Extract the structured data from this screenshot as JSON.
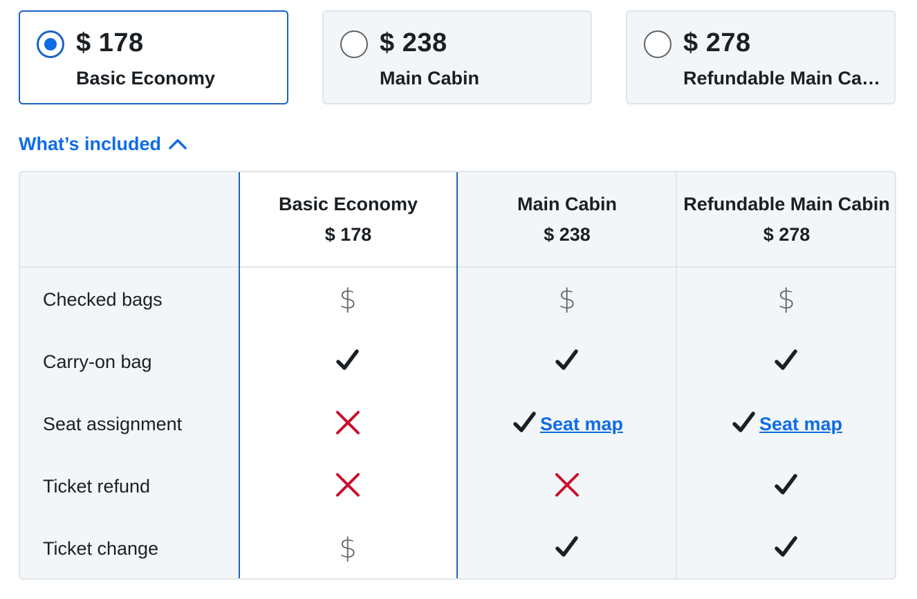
{
  "fare_options": [
    {
      "price": "$ 178",
      "name": "Basic Economy",
      "selected": true
    },
    {
      "price": "$ 238",
      "name": "Main Cabin",
      "selected": false
    },
    {
      "price": "$ 278",
      "name": "Refundable Main Cabin",
      "selected": false
    }
  ],
  "whats_included": {
    "label": "What’s included",
    "icon": "chevron-up-icon",
    "expanded": true
  },
  "comparison_table": {
    "columns": [
      {
        "name": "Basic Economy",
        "price": "$ 178"
      },
      {
        "name": "Main Cabin",
        "price": "$ 238"
      },
      {
        "name": "Refundable Main Cabin",
        "price": "$ 278"
      }
    ],
    "rows": [
      {
        "label": "Checked bags",
        "values": [
          "fee",
          "fee",
          "fee"
        ]
      },
      {
        "label": "Carry-on bag",
        "values": [
          "included",
          "included",
          "included"
        ]
      },
      {
        "label": "Seat assignment",
        "values": [
          "not-included",
          "included-seat-map",
          "included-seat-map"
        ]
      },
      {
        "label": "Ticket refund",
        "values": [
          "not-included",
          "not-included",
          "included"
        ]
      },
      {
        "label": "Ticket change",
        "values": [
          "fee",
          "included",
          "included"
        ]
      }
    ],
    "seat_map_label": "Seat map",
    "fee_symbol": "$"
  },
  "colors": {
    "accent": "#0f6ce6",
    "selected_border": "#1863c3",
    "cross": "#c8102e",
    "check": "#1a1f24"
  }
}
